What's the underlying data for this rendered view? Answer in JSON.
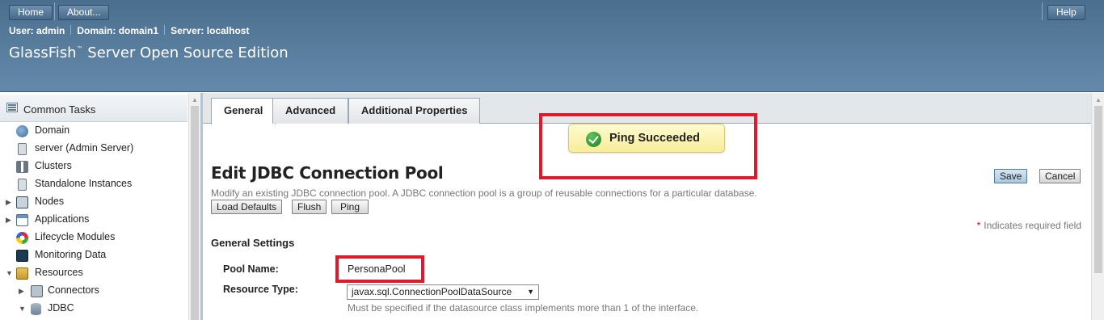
{
  "masthead": {
    "home_label": "Home",
    "about_label": "About...",
    "help_label": "Help",
    "user_label": "User:",
    "user_value": "admin",
    "domain_label": "Domain:",
    "domain_value": "domain1",
    "server_label": "Server:",
    "server_value": "localhost",
    "product_name": "GlassFish",
    "product_tm": "™",
    "product_suffix": " Server Open Source Edition"
  },
  "sidebar": {
    "header": "Common Tasks",
    "items": [
      {
        "label": "Domain",
        "icon": "domain-icon"
      },
      {
        "label": "server (Admin Server)",
        "icon": "server-icon"
      },
      {
        "label": "Clusters",
        "icon": "clusters-icon"
      },
      {
        "label": "Standalone Instances",
        "icon": "instance-icon"
      },
      {
        "label": "Nodes",
        "icon": "nodes-icon"
      },
      {
        "label": "Applications",
        "icon": "applications-icon"
      },
      {
        "label": "Lifecycle Modules",
        "icon": "lifecycle-icon"
      },
      {
        "label": "Monitoring Data",
        "icon": "monitoring-icon"
      },
      {
        "label": "Resources",
        "icon": "resources-icon"
      },
      {
        "label": "Connectors",
        "icon": "connectors-icon"
      },
      {
        "label": "JDBC",
        "icon": "database-icon"
      }
    ]
  },
  "tabs": [
    {
      "label": "General",
      "active": true
    },
    {
      "label": "Advanced",
      "active": false
    },
    {
      "label": "Additional Properties",
      "active": false
    }
  ],
  "alert": {
    "message": "Ping Succeeded",
    "status": "success",
    "color": "#f7ec9a"
  },
  "page": {
    "title": "Edit JDBC Connection Pool",
    "help": "Modify an existing JDBC connection pool. A JDBC connection pool is a group of reusable connections for a particular database.",
    "save_label": "Save",
    "cancel_label": "Cancel",
    "load_defaults_label": "Load Defaults",
    "flush_label": "Flush",
    "ping_label": "Ping",
    "required_mark": "*",
    "required_text": "Indicates required field",
    "section_title": "General Settings"
  },
  "form": {
    "pool_name_label": "Pool Name:",
    "pool_name_value": "PersonaPool",
    "resource_type_label": "Resource Type:",
    "resource_type_value": "javax.sql.ConnectionPoolDataSource",
    "resource_type_help": "Must be specified if the datasource class implements more than 1 of the interface."
  },
  "colors": {
    "masthead": "#5a7f9f",
    "highlight": "#e01a2a",
    "alert_bg": "#f7ec9a"
  }
}
